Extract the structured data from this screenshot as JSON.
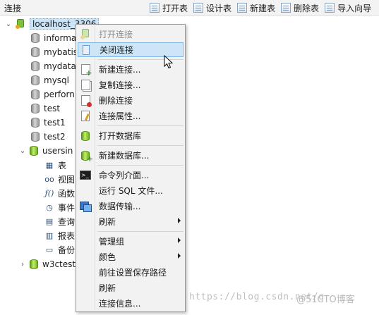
{
  "panel_title": "连接",
  "toolbar": {
    "buttons": [
      "打开表",
      "设计表",
      "新建表",
      "删除表",
      "导入向导"
    ]
  },
  "tree": {
    "connection": "localhost_3306",
    "databases": [
      {
        "label": "informa",
        "icon": "database-icon-gray"
      },
      {
        "label": "mybatis",
        "icon": "database-icon-gray"
      },
      {
        "label": "mydata",
        "icon": "database-icon-gray"
      },
      {
        "label": "mysql",
        "icon": "database-icon-gray"
      },
      {
        "label": "perforn",
        "icon": "database-icon-gray"
      },
      {
        "label": "test",
        "icon": "database-icon-gray"
      },
      {
        "label": "test1",
        "icon": "database-icon-gray"
      },
      {
        "label": "test2",
        "icon": "database-icon-gray"
      }
    ],
    "open_database": "usersin",
    "objects": [
      {
        "label": "表",
        "icon": "table-icon"
      },
      {
        "label": "视图",
        "icon": "view-icon"
      },
      {
        "label": "函数",
        "icon": "function-icon"
      },
      {
        "label": "事件",
        "icon": "event-icon"
      },
      {
        "label": "查询",
        "icon": "query-icon"
      },
      {
        "label": "报表",
        "icon": "report-icon"
      },
      {
        "label": "备份",
        "icon": "backup-icon"
      }
    ],
    "last_database": "w3ctest"
  },
  "context_menu": {
    "items": [
      {
        "label": "打开连接",
        "icon": "open-connection-icon",
        "state": "disabled"
      },
      {
        "label": "关闭连接",
        "icon": "close-connection-icon",
        "state": "highlighted"
      },
      {
        "label": "新建连接...",
        "icon": "new-connection-icon"
      },
      {
        "label": "复制连接...",
        "icon": "copy-connection-icon"
      },
      {
        "label": "删除连接",
        "icon": "delete-connection-icon"
      },
      {
        "label": "连接属性...",
        "icon": "connection-properties-icon"
      },
      {
        "label": "打开数据库",
        "icon": "open-database-icon"
      },
      {
        "label": "新建数据库...",
        "icon": "new-database-icon"
      },
      {
        "label": "命令列介面...",
        "icon": "console-icon"
      },
      {
        "label": "运行 SQL 文件...",
        "icon": ""
      },
      {
        "label": "数据传输...",
        "icon": "data-transfer-icon"
      },
      {
        "label": "刷新",
        "icon": "",
        "submenu": true
      },
      {
        "label": "管理组",
        "icon": "",
        "submenu": true
      },
      {
        "label": "颜色",
        "icon": "",
        "submenu": true
      },
      {
        "label": "前往设置保存路径",
        "icon": ""
      },
      {
        "label": "刷新",
        "icon": ""
      },
      {
        "label": "连接信息...",
        "icon": ""
      }
    ]
  },
  "watermark": {
    "url": "https://blog.csdn.net/q",
    "brand": "@51CTO博客"
  }
}
